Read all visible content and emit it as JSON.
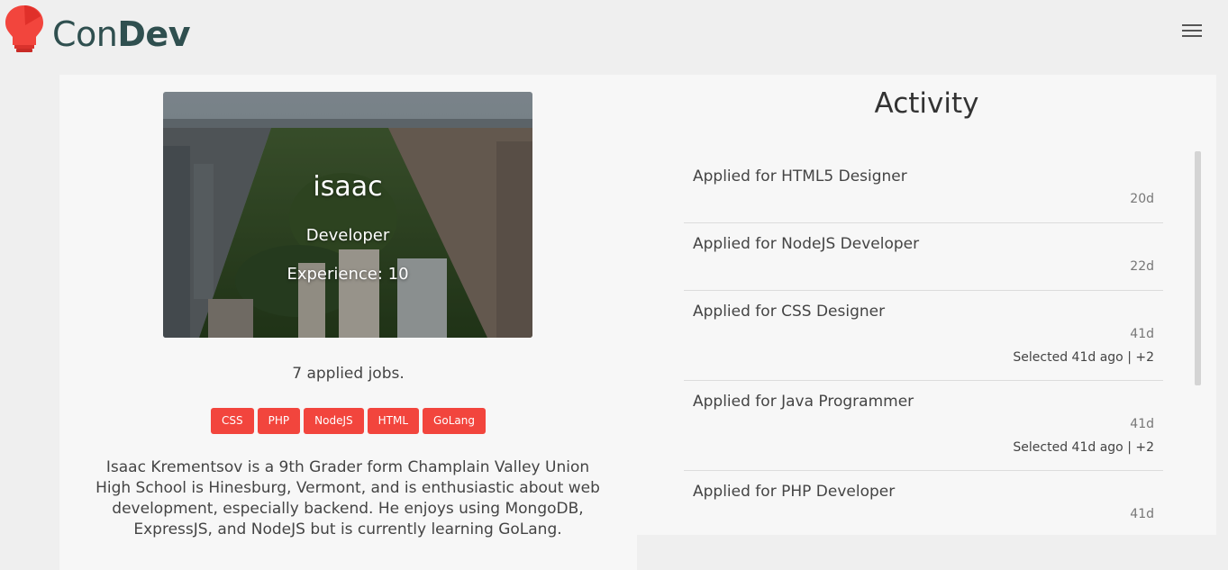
{
  "header": {
    "logo_light": "Con",
    "logo_bold": "Dev",
    "logo_color": "#f2453d",
    "menu_icon": "hamburger-menu-icon"
  },
  "profile": {
    "name": "isaac",
    "role": "Developer",
    "experience": "Experience: 10",
    "applied_jobs": "7 applied jobs.",
    "skills": [
      "CSS",
      "PHP",
      "NodeJS",
      "HTML",
      "GoLang"
    ],
    "skill_color": "#f2453d",
    "bio": "Isaac Krementsov is a 9th Grader form Champlain Valley Union High School is Hinesburg, Vermont, and is enthusiastic about web development, especially backend. He enjoys using MongoDB, ExpressJS, and NodeJS but is currently learning GoLang."
  },
  "activity": {
    "title": "Activity",
    "items": [
      {
        "title": "Applied for HTML5 Designer",
        "age": "20d",
        "status": ""
      },
      {
        "title": "Applied for NodeJS Developer",
        "age": "22d",
        "status": ""
      },
      {
        "title": "Applied for CSS Designer",
        "age": "41d",
        "status": "Selected 41d ago | +2"
      },
      {
        "title": "Applied for Java Programmer",
        "age": "41d",
        "status": "Selected 41d ago | +2"
      },
      {
        "title": "Applied for PHP Developer",
        "age": "41d",
        "status": ""
      }
    ]
  }
}
